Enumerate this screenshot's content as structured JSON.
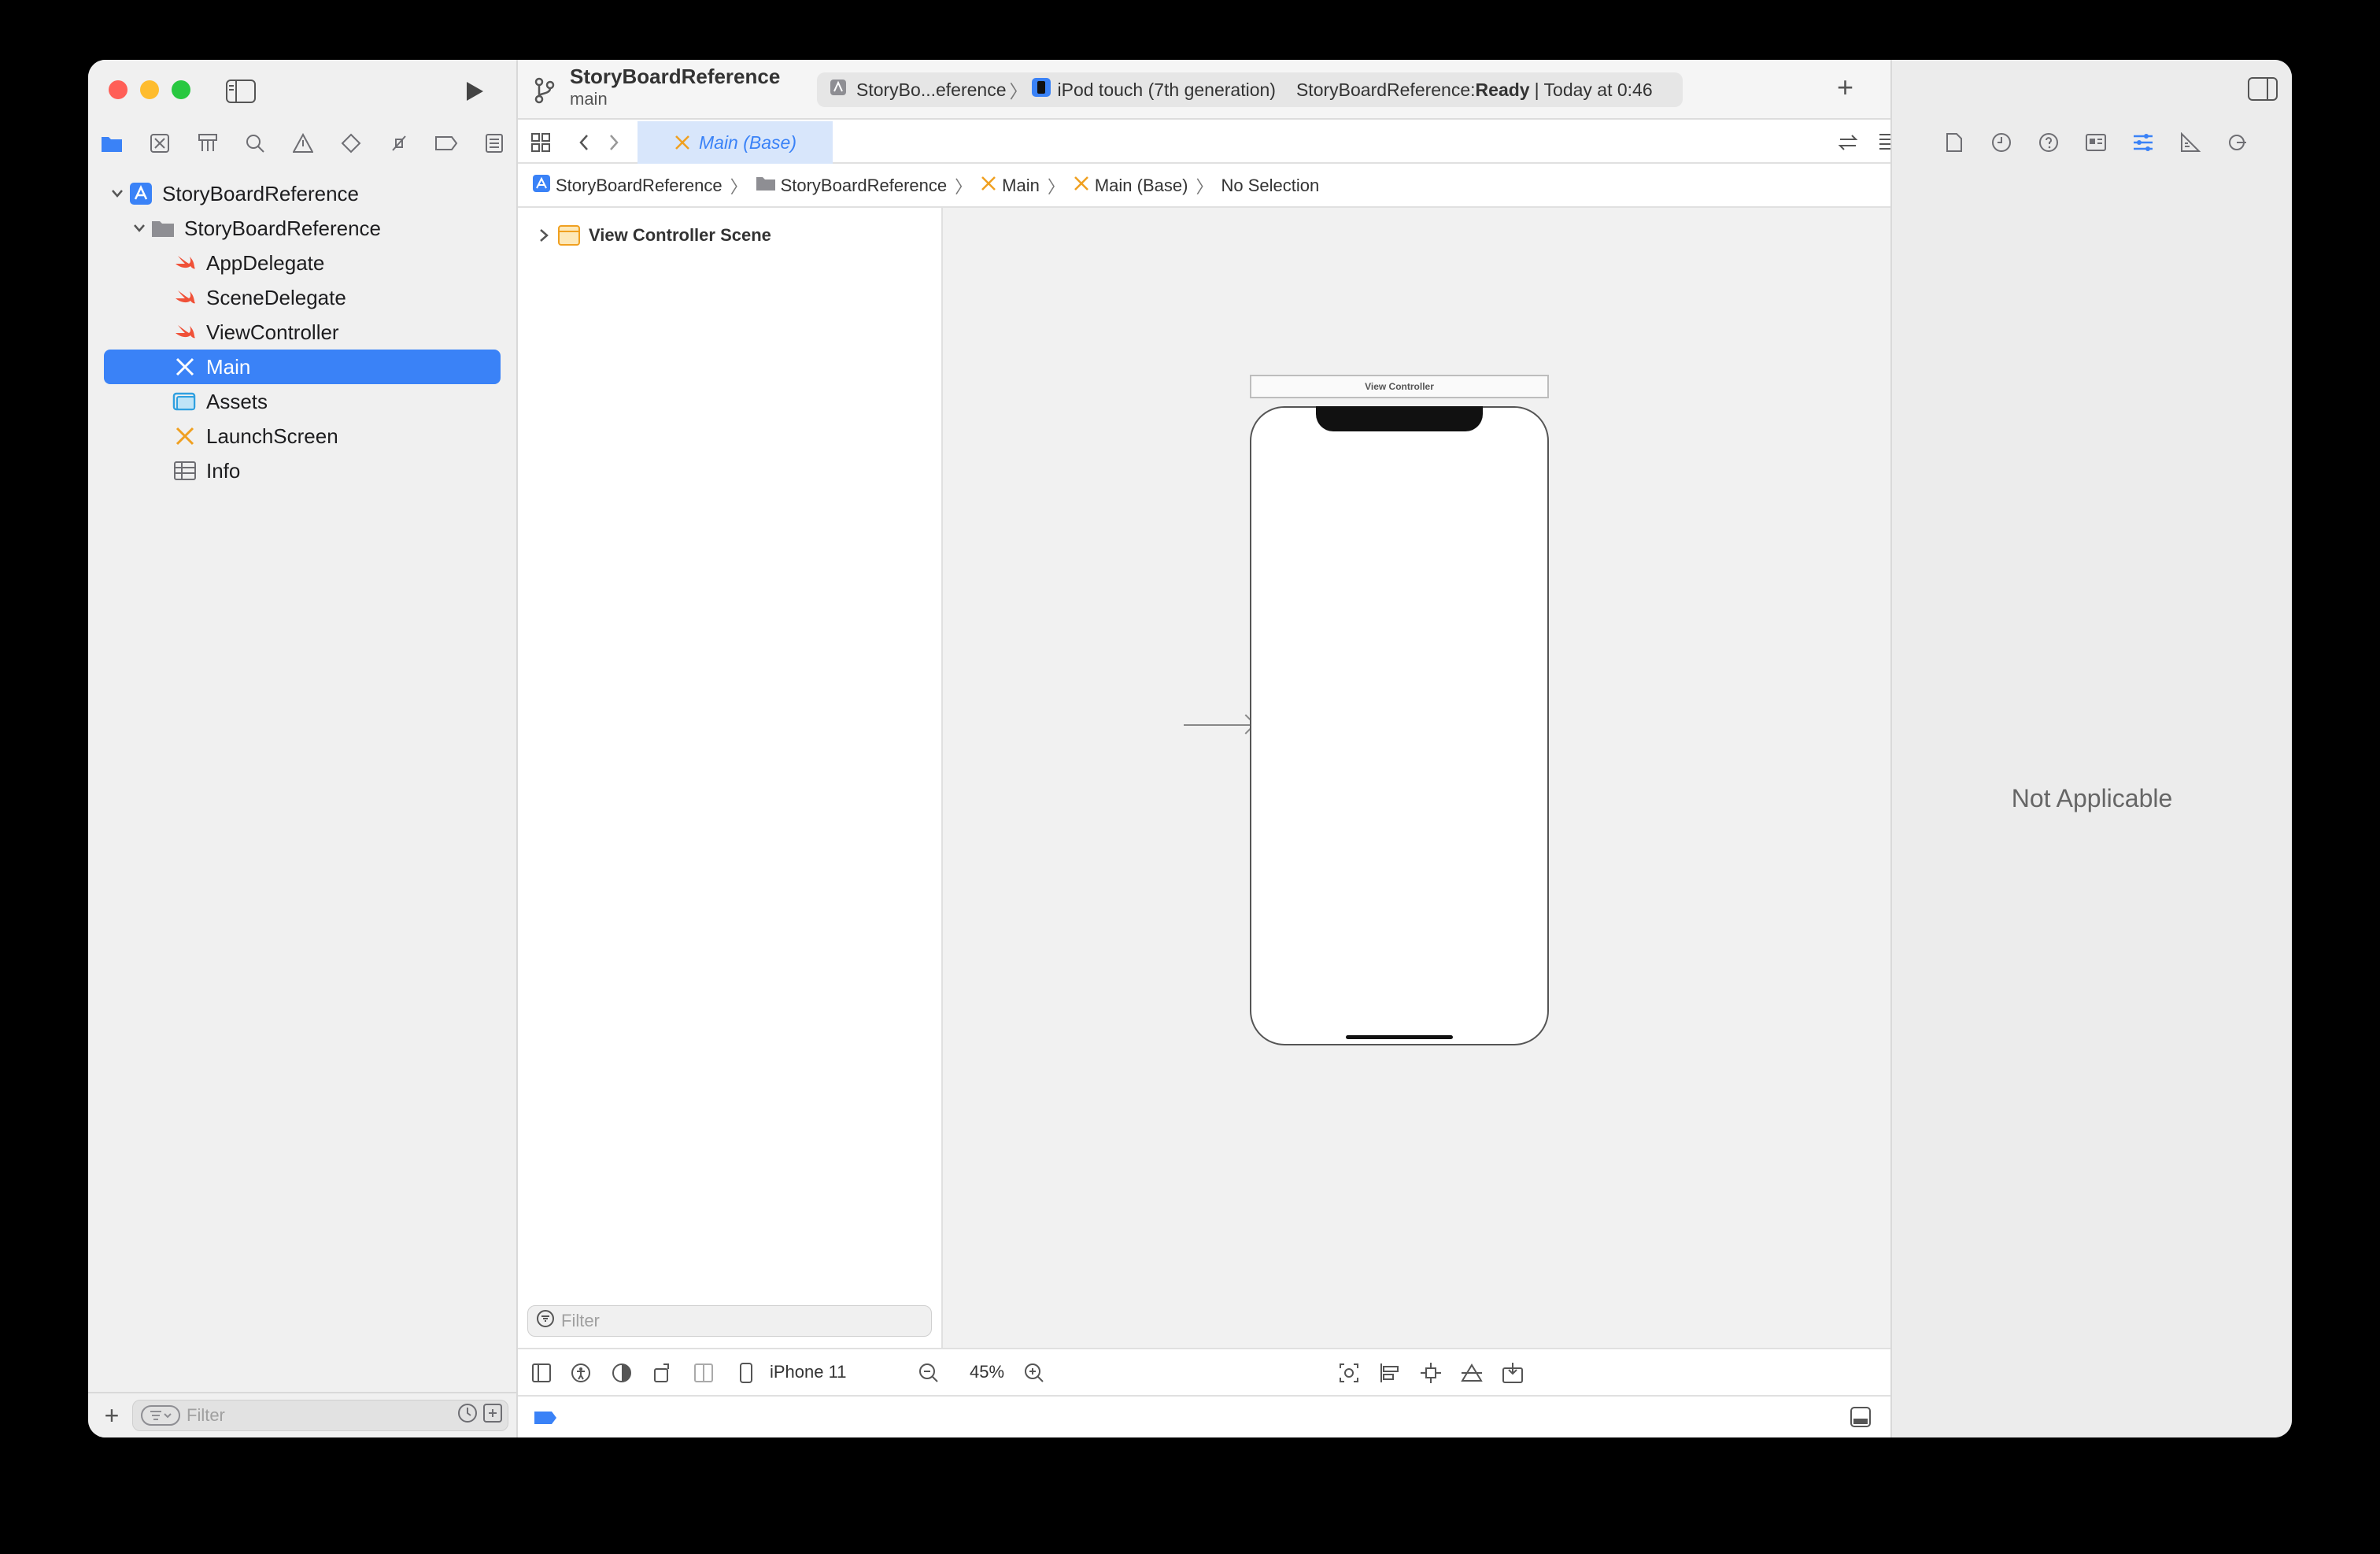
{
  "navigator": {
    "project_name": "StoryBoardReference",
    "group_name": "StoryBoardReference",
    "files": [
      {
        "label": "AppDelegate",
        "icon": "swift-icon"
      },
      {
        "label": "SceneDelegate",
        "icon": "swift-icon"
      },
      {
        "label": "ViewController",
        "icon": "swift-icon"
      },
      {
        "label": "Main",
        "icon": "storyboard-icon"
      },
      {
        "label": "Assets",
        "icon": "assets-icon"
      },
      {
        "label": "LaunchScreen",
        "icon": "storyboard-icon"
      },
      {
        "label": "Info",
        "icon": "plist-icon"
      }
    ],
    "filter_placeholder": "Filter"
  },
  "toolbar": {
    "project_title": "StoryBoardReference",
    "branch": "main",
    "scheme": "StoryBo...eference",
    "device": "iPod touch (7th generation)",
    "status_prefix": "StoryBoardReference: ",
    "status_state": "Ready",
    "status_time": "| Today at 0:46"
  },
  "editor": {
    "active_tab": "Main (Base)",
    "jumpbar": [
      "StoryBoardReference",
      "StoryBoardReference",
      "Main",
      "Main (Base)",
      "No Selection"
    ],
    "outline_scene": "View Controller Scene",
    "outline_filter_placeholder": "Filter",
    "scene_title": "View Controller",
    "device_label": "iPhone 11",
    "zoom": "45%"
  },
  "inspector": {
    "empty_text": "Not Applicable"
  },
  "colors": {
    "accent": "#3a82f7",
    "swift": "#f05138",
    "storyboard": "#f0a020"
  }
}
